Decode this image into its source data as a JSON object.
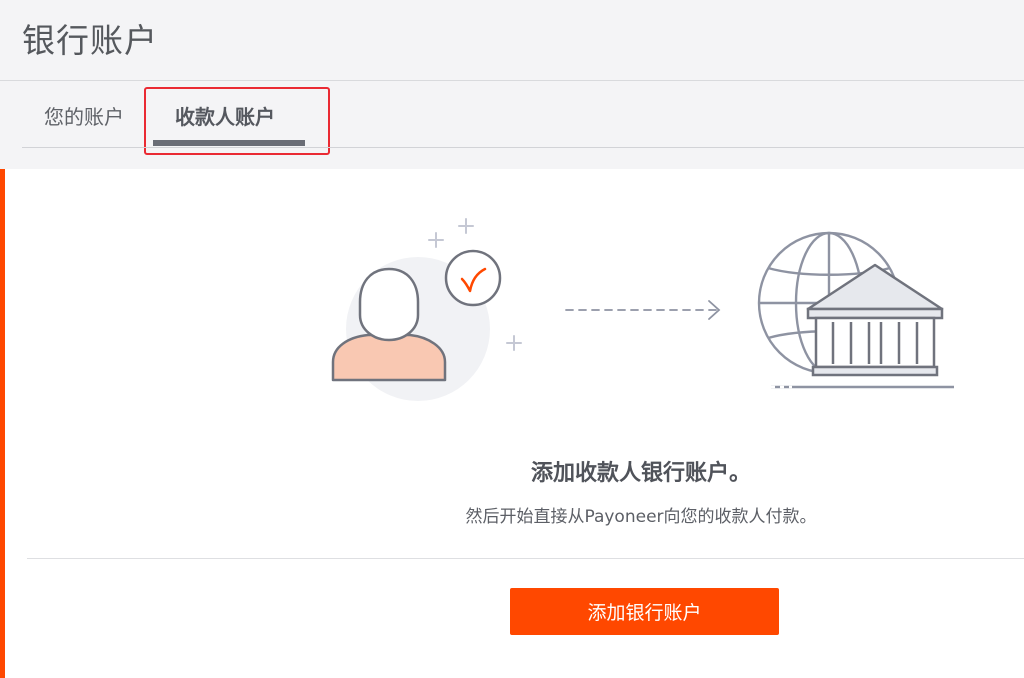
{
  "header": {
    "title": "银行账户"
  },
  "tabs": [
    {
      "label": "您的账户",
      "active": false
    },
    {
      "label": "收款人账户",
      "active": true
    }
  ],
  "empty_state": {
    "title": "添加收款人银行账户。",
    "subtitle": "然后开始直接从Payoneer向您的收款人付款。",
    "button_label": "添加银行账户"
  },
  "icons": [
    "user-avatar-icon",
    "sparkle-plus-icon",
    "check-circle-icon",
    "dashed-arrow-icon",
    "globe-icon",
    "bank-building-icon"
  ],
  "colors": {
    "accent": "#ff4800",
    "button": "#ff4800",
    "highlight_box": "#ea2a33",
    "avatar_fill": "#f9c8b2",
    "icon_stroke": "#8e93a2"
  }
}
